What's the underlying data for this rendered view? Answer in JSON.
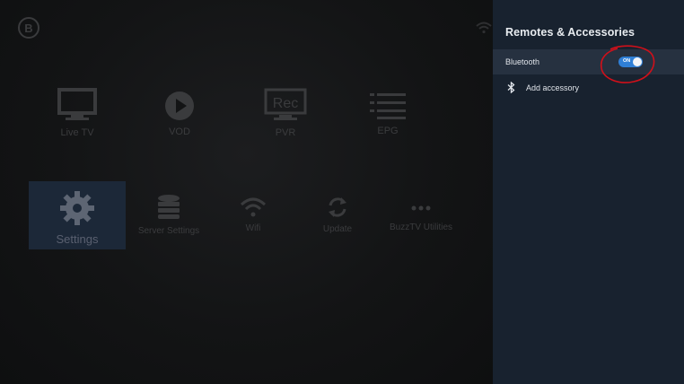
{
  "home": {
    "row1": [
      {
        "label": "Live TV",
        "icon": "tv-icon"
      },
      {
        "label": "VOD",
        "icon": "play-icon"
      },
      {
        "label": "PVR",
        "icon": "rec-icon"
      },
      {
        "label": "EPG",
        "icon": "list-icon"
      }
    ],
    "rec_text": "Rec",
    "row2": [
      {
        "label": "Settings",
        "icon": "gear-icon",
        "selected": true
      },
      {
        "label": "Server Settings",
        "icon": "database-icon"
      },
      {
        "label": "Wifi",
        "icon": "wifi-icon"
      },
      {
        "label": "Update",
        "icon": "refresh-icon"
      },
      {
        "label": "BuzzTV Utilities",
        "icon": "more-icon"
      }
    ]
  },
  "panel": {
    "title": "Remotes & Accessories",
    "bluetooth": {
      "label": "Bluetooth",
      "toggle_text": "ON",
      "enabled": true
    },
    "add_accessory": {
      "label": "Add accessory",
      "icon": "bluetooth-icon"
    }
  },
  "colors": {
    "panel_bg": "#18222f",
    "toggle_on": "#2f7fd6",
    "selection": "#1c2838",
    "annotation": "#d0101a"
  }
}
